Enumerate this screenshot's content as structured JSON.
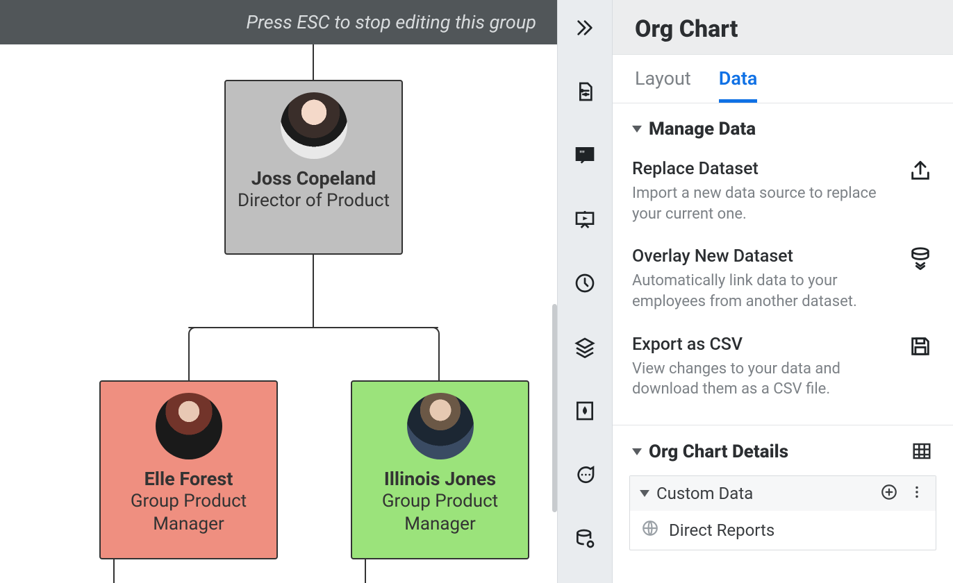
{
  "canvas": {
    "hint": "Press ESC to stop editing this group",
    "nodes": {
      "director": {
        "name": "Joss Copeland",
        "title": "Director of Product"
      },
      "elle": {
        "name": "Elle Forest",
        "title": "Group Product Manager"
      },
      "illinois": {
        "name": "Illinois Jones",
        "title": "Group Product Manager"
      }
    }
  },
  "panel": {
    "title": "Org Chart",
    "tabs": {
      "layout": "Layout",
      "data": "Data"
    },
    "manage": {
      "heading": "Manage Data",
      "replace": {
        "title": "Replace Dataset",
        "desc": "Import a new data source to replace your current one."
      },
      "overlay": {
        "title": "Overlay New Dataset",
        "desc": "Automatically link data to your employees from another dataset."
      },
      "export": {
        "title": "Export as CSV",
        "desc": "View changes to your data and download them as a CSV file."
      }
    },
    "details": {
      "heading": "Org Chart Details",
      "custom_heading": "Custom Data",
      "direct_reports": "Direct Reports"
    }
  }
}
